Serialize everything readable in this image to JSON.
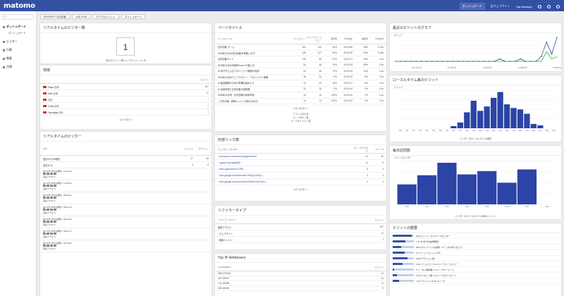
{
  "topbar": {
    "logo": "matomo",
    "nav": [
      "ダッシュボード",
      "全ウェブサイト",
      "Tag Manager"
    ]
  },
  "sidebar": {
    "search_placeholder": "",
    "items": [
      {
        "label": "ダッシュボード"
      },
      {
        "label": "ビジター"
      },
      {
        "label": "行動"
      },
      {
        "label": "集客"
      },
      {
        "label": "目標"
      }
    ],
    "sub_items": [
      "ダッシュボード"
    ]
  },
  "controls": [
    "ROOSEPT 社内訪客",
    "12月 2018",
    "すべてのビジット",
    "ダッシュボード"
  ],
  "realtime_count": {
    "title": "リアルタイムのビジター数",
    "value": "1",
    "caption": "訪れたビジット数 1 ≡ アクション 1 ≡ 分"
  },
  "region": {
    "title": "地域",
    "header": "ビジット",
    "rows": [
      {
        "name": "Tokyo 日本",
        "value": "247"
      },
      {
        "name": "Aichi 日本",
        "value": "11"
      },
      {
        "name": "日本",
        "value": "7"
      },
      {
        "name": "Chiba 日本",
        "value": "1"
      },
      {
        "name": "Yamagata 日本",
        "value": "1"
      }
    ],
    "pager": "1-5 / 6  次へ ›"
  },
  "realtime_visitors": {
    "title": "リアルタイムのビジター",
    "cols": [
      "日付",
      "ビジット",
      "アクション"
    ],
    "summary": [
      {
        "label": "過去24 分の時間",
        "v1": "27",
        "v2": "49"
      },
      {
        "label": "過去30 分",
        "v1": "4",
        "v2": "8"
      }
    ],
    "visits": [
      {
        "time": "金 12月 28日の時間 - 10:16:16",
        "label": "直接アクセス"
      },
      {
        "time": "金 12月 28日の時間 - 10:05:21",
        "label": "直接アクセス"
      },
      {
        "time": "金 12月 28日の時間 - 09:55:41",
        "label": "直接アクセス"
      },
      {
        "time": "金 12月 28日の時間 - 09:52:14",
        "label": "直接アクセス"
      },
      {
        "time": "金 12月 28日の時間 - 09:41:54",
        "label": "直接アクセス"
      },
      {
        "time": "金 12月 28日の時間 - 09:41:17",
        "label": "直接アクセス"
      },
      {
        "time": "金 12月 28日の時間 - 09:15:02",
        "label": "直接アクセス"
      }
    ]
  },
  "page_titles": {
    "title": "ページタイトル",
    "cols": [
      "ページタイトル",
      "ページビュー",
      "ユニークページビュー",
      "直帰率",
      "平均滞在",
      "離脱率",
      "平均生成"
    ],
    "rows": [
      {
        "name": "社内訪客 ホーム",
        "c1": "281",
        "c2": "149",
        "c3": "50%",
        "c4": "00:00:56",
        "c5": "38%",
        "c6": "0.14s"
      },
      {
        "name": "2018年12月の社内訪客を準備します！",
        "c1": "190",
        "c2": "127",
        "c3": "83%",
        "c4": "00:00:36",
        "c5": "61%",
        "c6": "0.08s"
      },
      {
        "name": "社内訪客ガイド",
        "c1": "136",
        "c2": "86",
        "c3": "47%",
        "c4": "00:00:21",
        "c5": "35%",
        "c6": "0.1s"
      },
      {
        "name": "2018年12月の利用iPhone-7の使い方",
        "c1": "90",
        "c2": "46",
        "c3": "76%",
        "c4": "00:00:33",
        "c5": "56%",
        "c6": "0.2s"
      },
      {
        "name": "AI 事才子によるプロジェクト管理の改善? ",
        "c1": "53",
        "c2": "46",
        "c3": "17%",
        "c4": "00:00:18",
        "c5": "13%",
        "c6": "0.3s"
      },
      {
        "name": "2018年12月のウェブマガジン｜プロジェクト管理",
        "c1": "48",
        "c2": "34",
        "c3": "0%",
        "c4": "00:00:13",
        "c5": "5%",
        "c6": "0.3s"
      },
      {
        "name": "AI 製品開発のための準備を始めよう",
        "c1": "34",
        "c2": "20",
        "c3": "33%",
        "c4": "00:00:17",
        "c5": "8%",
        "c6": "0.2s"
      },
      {
        "name": "AI 活用事例と社内訪客の技術展",
        "c1": "20",
        "c2": "16",
        "c3": "0%",
        "c4": "00:00:10",
        "c5": "2%",
        "c6": "0.2s"
      },
      {
        "name": "2018年12月号 - 社内訪客の利用事例",
        "c1": "15",
        "c2": "15",
        "c3": "100%",
        "c4": "00:00:15",
        "c5": "0%",
        "c6": "0.2s"
      },
      {
        "name": "この先手帳 - 即時エンジン分析の手引き",
        "c1": "14",
        "c2": "13",
        "c3": "100%",
        "c4": "00:00:02",
        "c5": "0%",
        "c6": "0.2s"
      }
    ],
    "pager": "1-10 / 35  次へ ›",
    "links": [
      "フラット化する",
      "ページURL一覧",
      "ページタイトル一覧"
    ]
  },
  "external_links": {
    "title": "外部リンク数",
    "cols": [
      "ウェブサイトの URL",
      "ユニークアクセス",
      "ユニーク"
    ],
    "rows": [
      {
        "name": "› connpass.com/user/rooseptjp/events?",
        "v1": "20",
        "v2": "20"
      },
      {
        "name": "› r.gnavi.co.jp/g3g3g7tl",
        "v1": "11",
        "v2": "8"
      },
      {
        "name": "› atnd.org/events/101795/",
        "v1": "8",
        "v2": "4"
      },
      {
        "name": "› docs.google.com/forms/d/e/1FAIpQLSe0y1...",
        "v1": "4",
        "v2": "4"
      },
      {
        "name": "› docs.google.com/forms/d/e/1FAIpQLSdTYaXz...",
        "v1": "4",
        "v2": "4"
      }
    ],
    "pager": "1-5 / 14  次へ ›"
  },
  "referrer_type": {
    "title": "リファラータイプ",
    "cols": [
      "リファラータイプ",
      "ビジット"
    ],
    "rows": [
      {
        "name": "直接アクセス",
        "v": "327"
      },
      {
        "name": "› ウェブサイト",
        "v": "11"
      },
      {
        "name": "› 検索エンジン",
        "v": "1"
      }
    ]
  },
  "top_ip": {
    "title": "Top IP-Addresses",
    "cols": [
      "IP ADDRESS",
      "ビジット"
    ],
    "rows": [
      {
        "name": "155.179.204",
        "v": "32"
      },
      {
        "name": "157.192.97",
        "v": "24"
      },
      {
        "name": "172.132.58",
        "v": "11"
      },
      {
        "name": "128.104.98",
        "v": "9"
      }
    ]
  },
  "recent_visits_graph": {
    "title": "最近のビジットのグラフ",
    "legend": "ビジット",
    "x_labels": [
      "2017年12月",
      "2018年3月",
      "2018年6月",
      "2018年9月",
      "2018年12月"
    ],
    "values": [
      0,
      0,
      0,
      0,
      0,
      0,
      0,
      0,
      0,
      0,
      0,
      0,
      0,
      0,
      0,
      0,
      0,
      0,
      0,
      0,
      1,
      0,
      0,
      0,
      1,
      0,
      0,
      0,
      2,
      8,
      3,
      10
    ],
    "values2": [
      0,
      0,
      0,
      0,
      0,
      0,
      0,
      0,
      0,
      0,
      0,
      0,
      0,
      0,
      0,
      0,
      0,
      0,
      0,
      0,
      0,
      0,
      0,
      0,
      0,
      0,
      0,
      0,
      0,
      4,
      1,
      2
    ]
  },
  "local_time_chart": {
    "title": "ローカルタイム毎のビジット",
    "legend": "ビジット",
    "chart_data": {
      "type": "bar",
      "categories": [
        "0時",
        "1時",
        "2時",
        "3時",
        "4時",
        "5時",
        "6時",
        "7時",
        "8時",
        "9時",
        "10時",
        "11時",
        "12時",
        "13時",
        "14時",
        "15時",
        "16時",
        "17時",
        "18時",
        "19時",
        "20時",
        "21時",
        "22時",
        "23時"
      ],
      "values": [
        0,
        0,
        0,
        0,
        0,
        0,
        0,
        0,
        3,
        8,
        22,
        38,
        24,
        30,
        42,
        50,
        33,
        28,
        26,
        20,
        6,
        4,
        0,
        0
      ],
      "title": "ローカルタイム毎のビジット"
    },
    "caption": "ビジターのローカルタイム時間"
  },
  "daily_visits": {
    "title": "毎日訪問数",
    "legend": "ユニークビジター",
    "chart_data": {
      "type": "bar",
      "categories": [
        "12/21",
        "12/22",
        "12/23",
        "12/24",
        "12/25",
        "12/26",
        "12/27",
        "12/28"
      ],
      "values": [
        24,
        35,
        50,
        36,
        40,
        26,
        42,
        0
      ],
      "title": "毎日訪問数"
    },
    "caption": "ビジターのローカルタイム毎のビジット"
  },
  "visits_overview": {
    "title": "ビジットの概要",
    "rows": [
      {
        "text": "330 ビジット、81 ユニークビジター",
        "w": 90
      },
      {
        "text": "1 分 40 秒 平均訪問時間",
        "w": 60
      },
      {
        "text": "29% がワンページの訪問（ページを1件で去った）",
        "w": 40
      },
      {
        "text": "2.6 ページ / ビジット平均",
        "w": 55
      },
      {
        "text": "8,680 アクション数",
        "w": 70
      },
      {
        "text": "1.96 ページビュー 52 ユニークページビュー",
        "w": 45
      },
      {
        "text": "0 トータル検索数 0 ユニークキーワード",
        "w": 8
      },
      {
        "text": "8 ダウンロード数 4 ユニークダウンロード",
        "w": 20
      },
      {
        "text": "1.73 アウトリンク 86 ユニーク",
        "w": 30
      }
    ]
  }
}
